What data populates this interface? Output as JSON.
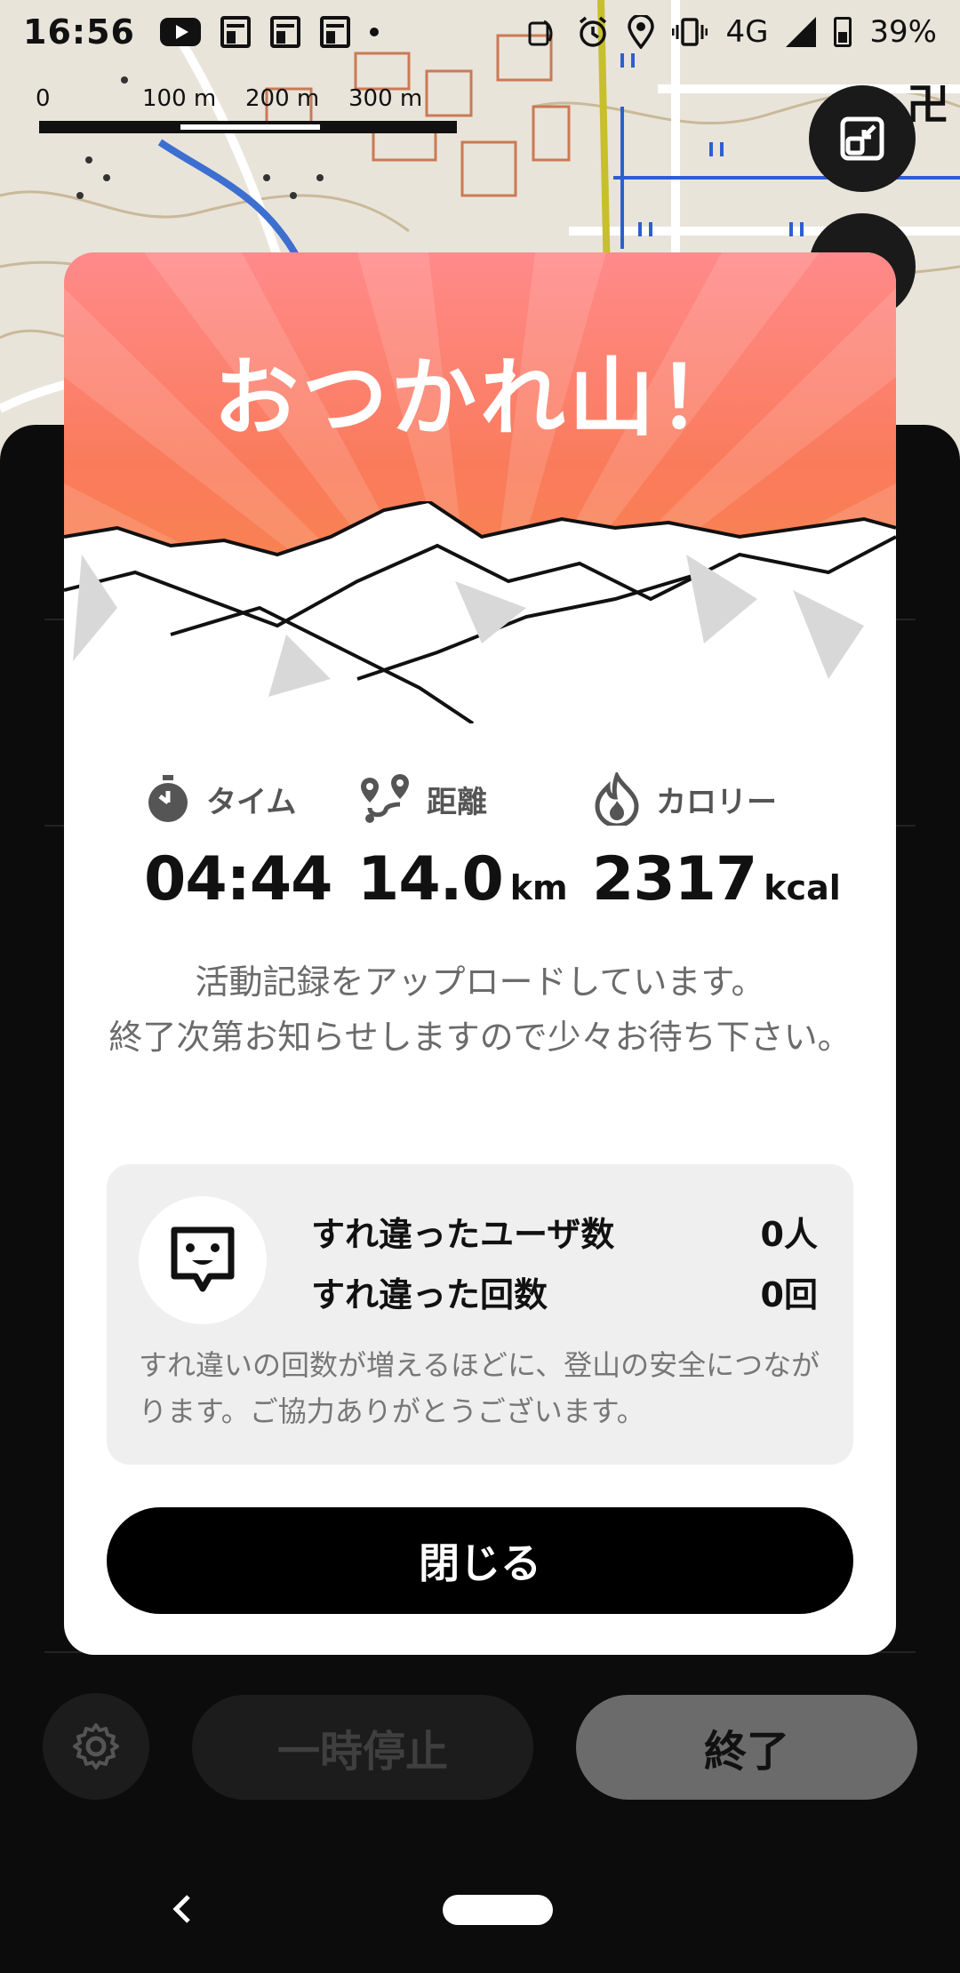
{
  "status_bar": {
    "time": "16:56",
    "network": "4G",
    "battery": "39%",
    "icons_left": [
      "youtube-icon",
      "news-icon",
      "news-icon",
      "news-icon",
      "dot-icon"
    ],
    "icons_right": [
      "nfc-icon",
      "alarm-icon",
      "location-icon",
      "vibrate-icon",
      "signal-icon",
      "battery-icon"
    ]
  },
  "map": {
    "scale_labels": [
      "0",
      "100 m",
      "200 m",
      "300 m"
    ],
    "temple_symbol": "卍"
  },
  "modal": {
    "title": "おつかれ山！",
    "stats": {
      "time": {
        "label": "タイム",
        "value": "04:44",
        "icon": "stopwatch-icon"
      },
      "distance": {
        "label": "距離",
        "value": "14.0",
        "unit": "km",
        "icon": "route-icon"
      },
      "calories": {
        "label": "カロリー",
        "value": "2317",
        "unit": "kcal",
        "icon": "flame-icon"
      }
    },
    "message_line1": "活動記録をアップロードしています。",
    "message_line2": "終了次第お知らせしますので少々お待ち下さい。",
    "encounter": {
      "users_label": "すれ違ったユーザ数",
      "users_value": "0人",
      "count_label": "すれ違った回数",
      "count_value": "0回",
      "note": "すれ違いの回数が増えるほどに、登山の安全につながります。ご協力ありがとうございます。"
    },
    "close_label": "閉じる"
  },
  "controls": {
    "pause_label": "一時停止",
    "end_label": "終了"
  },
  "colors": {
    "hero_top": "#ff8a8a",
    "hero_bottom": "#f58c3e",
    "primary_button": "#000000",
    "end_button": "#6b6b6b"
  }
}
